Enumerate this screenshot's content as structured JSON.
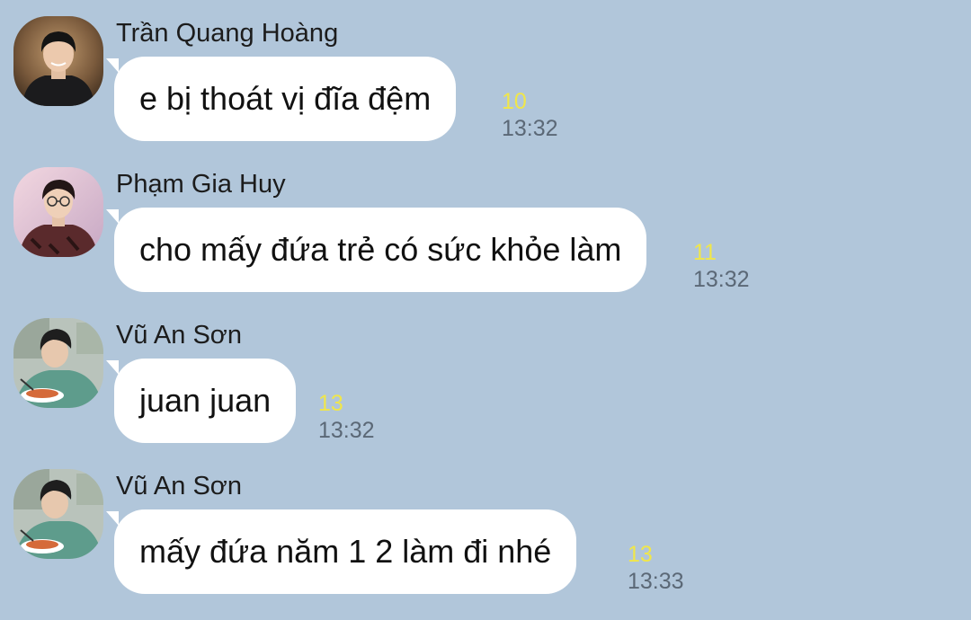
{
  "messages": [
    {
      "sender": "Trần Quang Hoàng",
      "text": "e bị thoát vị đĩa đệm",
      "read_count": "10",
      "time": "13:32",
      "avatar_icon": "person-photo-icon"
    },
    {
      "sender": "Phạm Gia Huy",
      "text": "cho mấy đứa trẻ có sức khỏe làm",
      "read_count": "11",
      "time": "13:32",
      "avatar_icon": "person-photo-icon"
    },
    {
      "sender": "Vũ An Sơn",
      "text": "juan juan",
      "read_count": "13",
      "time": "13:32",
      "avatar_icon": "person-eating-photo-icon"
    },
    {
      "sender": "Vũ An Sơn",
      "text": "mấy đứa năm 1 2 làm đi nhé",
      "read_count": "13",
      "time": "13:33",
      "avatar_icon": "person-eating-photo-icon"
    }
  ],
  "colors": {
    "background": "#b1c6da",
    "bubble": "#ffffff",
    "read_count": "#f0e64a",
    "time": "#5b6876"
  }
}
